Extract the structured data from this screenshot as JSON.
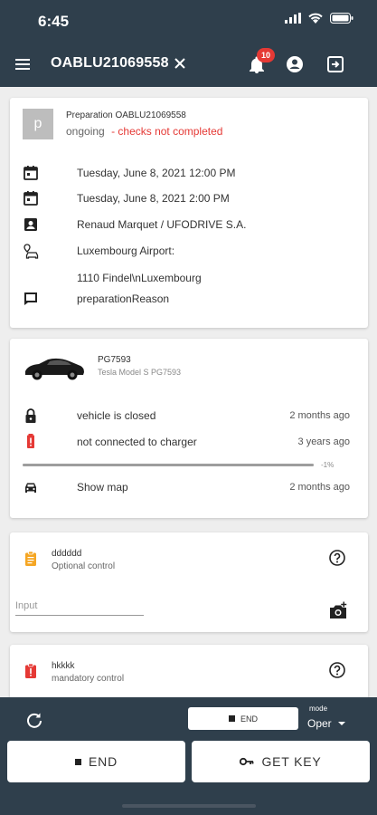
{
  "status_bar": {
    "time": "6:45"
  },
  "app_bar": {
    "title": "OABLU21069558",
    "notification_count": "10"
  },
  "preparation": {
    "avatar_letter": "p",
    "title": "Preparation OABLU21069558",
    "status": "ongoing",
    "warning": "- checks not completed",
    "start": "Tuesday, June 8, 2021 12:00 PM",
    "end": "Tuesday, June 8, 2021 2:00 PM",
    "customer": "Renaud Marquet / UFODRIVE S.A.",
    "location_name": "Luxembourg Airport:",
    "location_address": "1110 Findel\\nLuxembourg",
    "reason": "preparationReason"
  },
  "vehicle": {
    "plate": "PG7593",
    "model": "Tesla Model S PG7593",
    "lock_status": "vehicle is closed",
    "lock_time": "2 months ago",
    "charger_status": "not connected to charger",
    "charger_time": "3 years ago",
    "battery_percent": -1,
    "battery_label": "-1%",
    "map_label": "Show map",
    "map_time": "2 months ago"
  },
  "controls": [
    {
      "title": "dddddd",
      "subtitle": "Optional control",
      "input_placeholder": "Input",
      "icon": "clipboard-icon",
      "color": "#f5a623"
    },
    {
      "title": "hkkkk",
      "subtitle": "mandatory control",
      "icon": "clipboard-alert-icon",
      "color": "#e53935"
    }
  ],
  "bottom": {
    "small_end_label": "END",
    "mode_label": "mode",
    "mode_value": "Oper",
    "end_label": "END",
    "get_key_label": "GET KEY"
  },
  "colors": {
    "header_bg": "#2f3f4c",
    "warning": "#e53935",
    "optional": "#f5a623",
    "mandatory": "#e53935"
  }
}
